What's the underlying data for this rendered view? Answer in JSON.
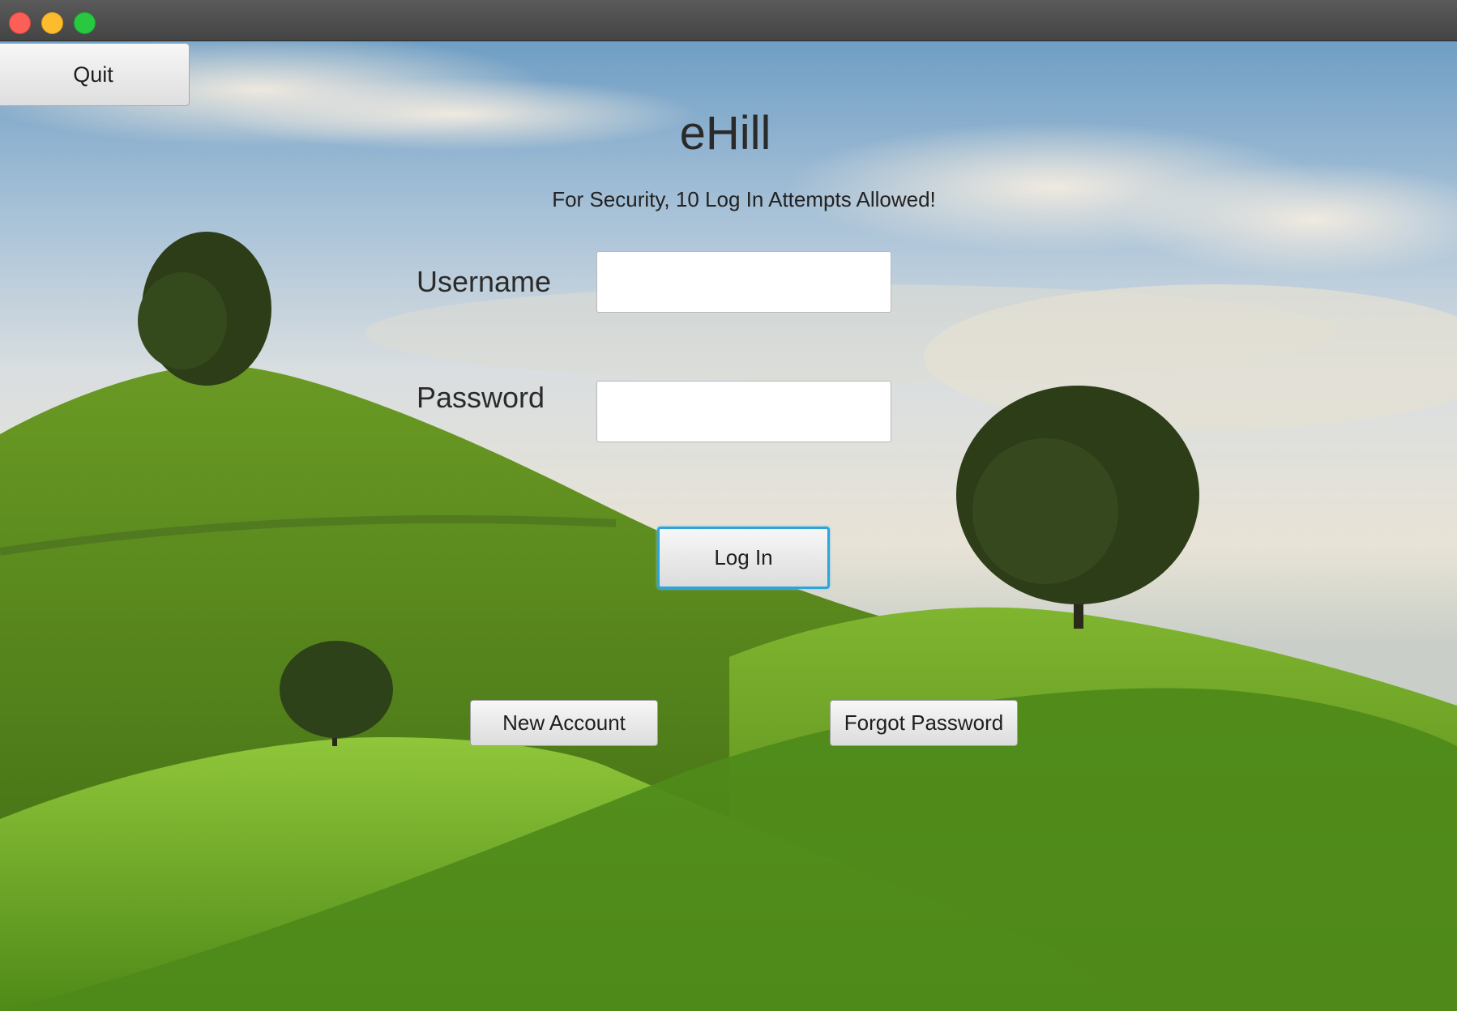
{
  "window": {
    "controls": [
      "close",
      "minimize",
      "maximize"
    ]
  },
  "toolbar": {
    "quit_label": "Quit"
  },
  "login": {
    "title": "eHill",
    "security_note": "For Security, 10 Log In Attempts Allowed!",
    "username_label": "Username",
    "username_value": "",
    "password_label": "Password",
    "password_value": "",
    "login_label": "Log In",
    "new_account_label": "New Account",
    "forgot_password_label": "Forgot Password"
  },
  "background": {
    "description_icon": "grassy-hills-landscape-icon",
    "colors": {
      "sky_top": "#6f9ec4",
      "sky_mid": "#d9dee0",
      "grass_dark": "#3f6d14",
      "grass_light": "#8cc43a",
      "tree": "#2c3d18"
    }
  },
  "colors": {
    "focus_ring": "#2ea4d8",
    "titlebar": "#4e4e4e",
    "close": "#fc5f57",
    "minimize": "#fdbc2e",
    "maximize": "#2ac840"
  }
}
